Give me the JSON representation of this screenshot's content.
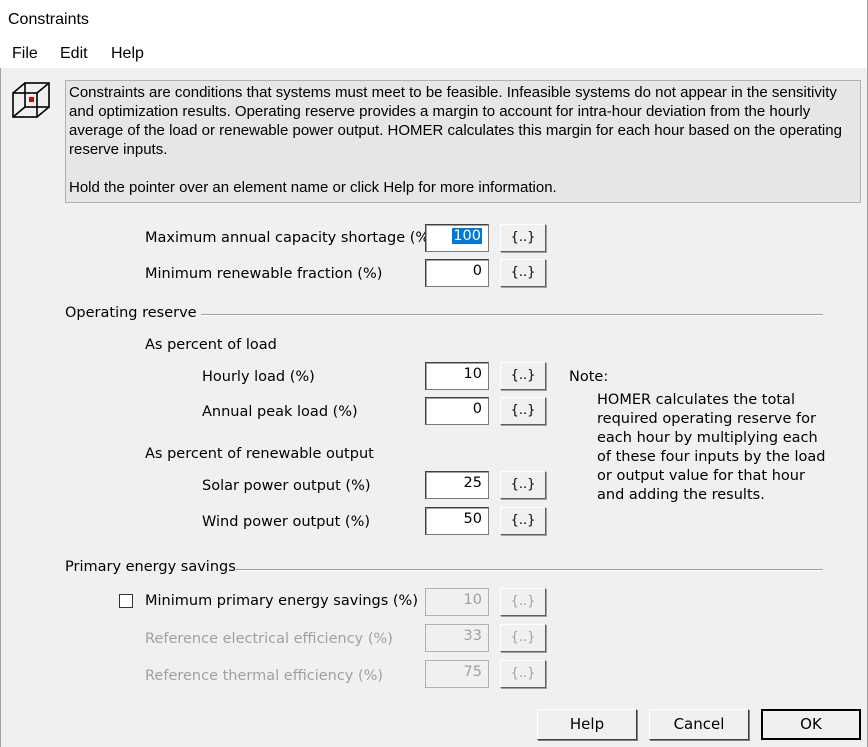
{
  "window": {
    "title": "Constraints"
  },
  "menu": {
    "items": [
      "File",
      "Edit",
      "Help"
    ]
  },
  "info": {
    "paragraph1": "Constraints are conditions that systems must meet to be feasible. Infeasible systems do not appear in the sensitivity and optimization results. Operating reserve provides a margin to account for intra-hour deviation from the hourly average of the load or renewable power output. HOMER calculates this margin for each hour based on the operating reserve inputs.",
    "paragraph2": "Hold the pointer over an element name or click Help for more information.",
    "icon": "cube-icon"
  },
  "constraints": {
    "max_capacity_shortage": {
      "label": "Maximum annual capacity shortage (%)",
      "value": "100"
    },
    "min_renewable_fraction": {
      "label": "Minimum renewable fraction (%)",
      "value": "0"
    }
  },
  "operating_reserve": {
    "title": "Operating reserve",
    "load_header": "As percent of load",
    "hourly_load": {
      "label": "Hourly load (%)",
      "value": "10"
    },
    "annual_peak_load": {
      "label": "Annual peak load (%)",
      "value": "0"
    },
    "renewable_header": "As percent of renewable output",
    "solar_output": {
      "label": "Solar power output (%)",
      "value": "25"
    },
    "wind_output": {
      "label": "Wind power output (%)",
      "value": "50"
    },
    "note_title": "Note:",
    "note_body": "HOMER calculates the total required operating reserve for each hour by multiplying each of these four inputs by the load or output value for that hour and adding the results."
  },
  "primary_energy": {
    "title": "Primary energy savings",
    "min_savings": {
      "label": "Minimum primary energy savings (%)",
      "value": "10",
      "checked": false
    },
    "ref_electrical": {
      "label": "Reference electrical efficiency (%)",
      "value": "33"
    },
    "ref_thermal": {
      "label": "Reference thermal efficiency (%)",
      "value": "75"
    }
  },
  "sensitivity_button_label": "{..}",
  "buttons": {
    "help": "Help",
    "cancel": "Cancel",
    "ok": "OK"
  }
}
